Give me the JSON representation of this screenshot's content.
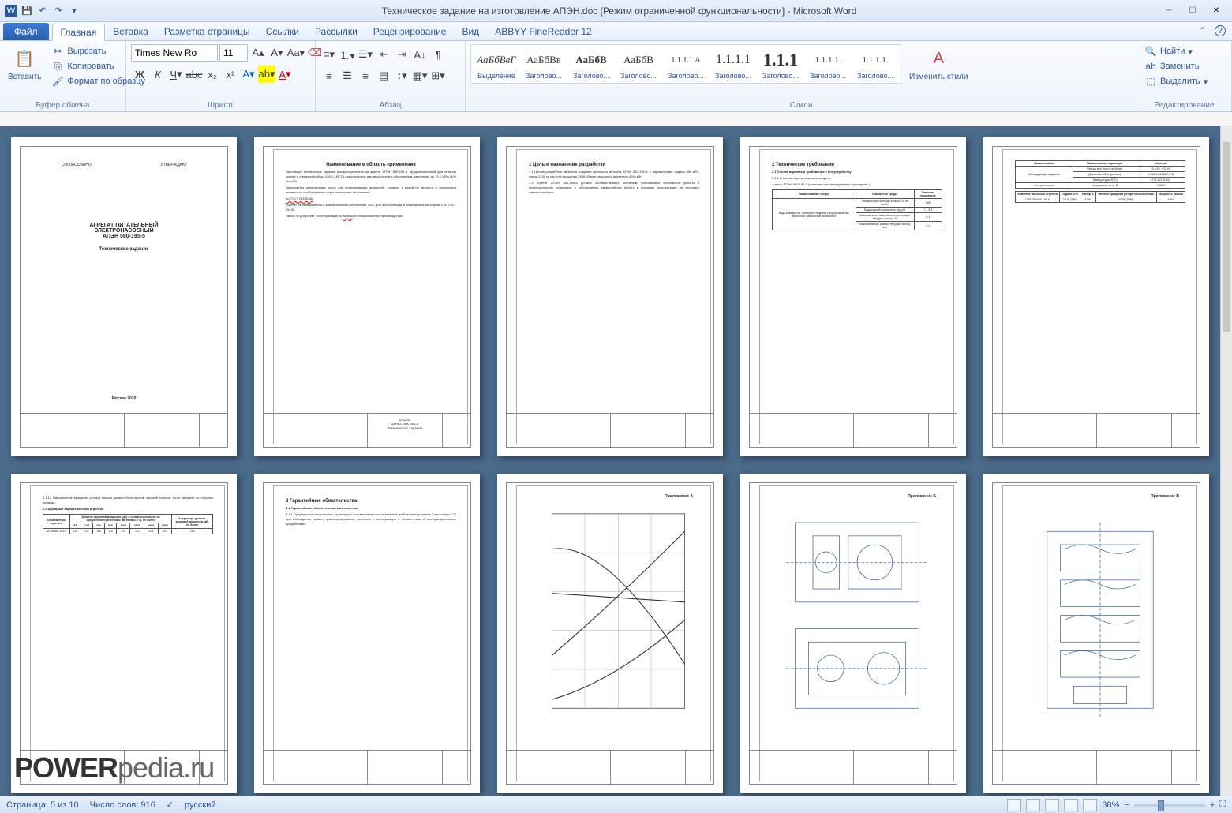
{
  "titlebar": {
    "title": "Техническое задание на изготовление АПЭН.doc  [Режим ограниченной функциональности]  -  Microsoft Word"
  },
  "tabs": {
    "file": "Файл",
    "items": [
      "Главная",
      "Вставка",
      "Разметка страницы",
      "Ссылки",
      "Рассылки",
      "Рецензирование",
      "Вид",
      "ABBYY FineReader 12"
    ],
    "active": 0
  },
  "ribbon": {
    "clipboard": {
      "label": "Буфер обмена",
      "paste": "Вставить",
      "cut": "Вырезать",
      "copy": "Копировать",
      "format": "Формат по образцу"
    },
    "font": {
      "label": "Шрифт",
      "name": "Times New Ro",
      "size": "11"
    },
    "paragraph": {
      "label": "Абзац"
    },
    "styles": {
      "label": "Стили",
      "change": "Изменить стили",
      "items": [
        {
          "preview": "АаБбВвГ",
          "name": "Выделение"
        },
        {
          "preview": "АаБбВв",
          "name": "Заголово..."
        },
        {
          "preview": "АаБбВ",
          "name": "Заголово..."
        },
        {
          "preview": "АаБбВ",
          "name": "Заголово..."
        },
        {
          "preview": "1.1.1.1 А",
          "name": "Заголово..."
        },
        {
          "preview": "1.1.1.1",
          "name": "Заголово..."
        },
        {
          "preview": "1.1.1",
          "name": "Заголово..."
        },
        {
          "preview": "1.1.1.1.",
          "name": "Заголово..."
        },
        {
          "preview": "1.1.1.1.",
          "name": "Заголово..."
        }
      ]
    },
    "editing": {
      "label": "Редактирование",
      "find": "Найти",
      "replace": "Заменить",
      "select": "Выделить"
    }
  },
  "doc": {
    "page1": {
      "approve_l": "СОГЛАСОВАНО",
      "approve_r": "УТВЕРЖДАЮ",
      "t1": "АГРЕГАТ ПИТАТЕЛЬНЫЙ",
      "t2": "ЭЛЕКТРОНАСОСНЫЙ",
      "t3": "АПЭН 580-195-5",
      "sub": "Техническое задание",
      "city": "Москва 2020"
    },
    "page2": {
      "h": "Наименование и область применения",
      "stamp1": "Агрегат",
      "stamp2": "АПЭН 580-195-5",
      "stamp3": "Техническое задание"
    },
    "page3": {
      "h": "1  Цель и назначение разработки"
    },
    "page4": {
      "h": "2  Технические требования",
      "h2": "2.1 Состав агрегата и требования к его устройству"
    },
    "page8": {
      "h": "3  Гарантийные обязательства",
      "app": "Приложение А"
    },
    "page9": {
      "app": "Приложение Б"
    },
    "page10": {
      "app": "Приложение В"
    }
  },
  "status": {
    "page": "Страница: 5 из 10",
    "words": "Число слов: 916",
    "lang": "русский",
    "zoom": "38%"
  },
  "watermark": {
    "a": "POWER",
    "b": "pedia.ru"
  }
}
